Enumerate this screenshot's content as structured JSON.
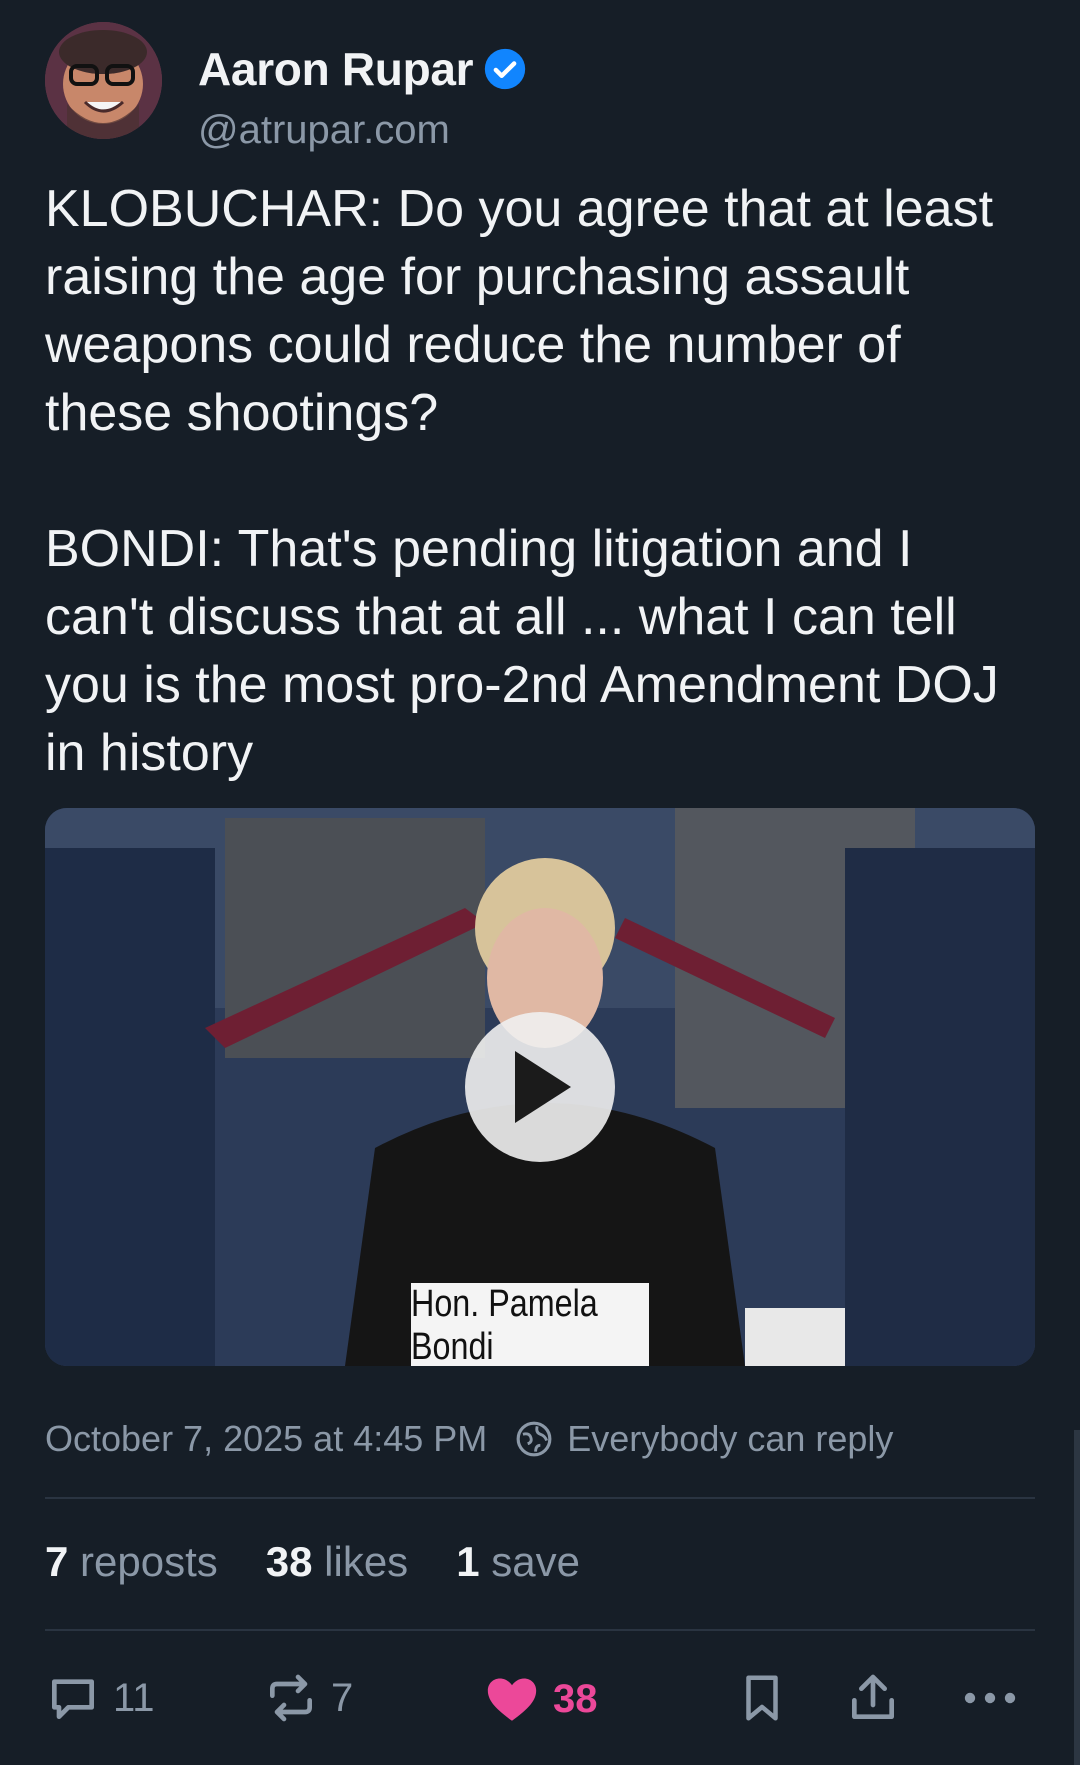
{
  "author": {
    "name": "Aaron Rupar",
    "handle": "@atrupar.com",
    "verified": true,
    "avatar_icon": "avatar-photo"
  },
  "post": {
    "text": "KLOBUCHAR: Do you agree that at least raising the age for purchasing assault weapons could reduce the number of these shootings?\n\nBONDI: That's pending litigation and I can't discuss that at all ... what I can tell you is the most pro-2nd Amendment DOJ in history",
    "video": {
      "nameplate": "Hon. Pamela Bondi",
      "play_icon": "play-icon"
    }
  },
  "meta": {
    "timestamp": "October 7, 2025 at 4:45 PM",
    "reply_setting": "Everybody can reply"
  },
  "stats": {
    "reposts_count": "7",
    "reposts_label": "reposts",
    "likes_count": "38",
    "likes_label": "likes",
    "saves_count": "1",
    "saves_label": "save"
  },
  "actions": {
    "reply_count": "11",
    "repost_count": "7",
    "like_count": "38"
  },
  "colors": {
    "background": "#161e27",
    "accent": "#1185fe",
    "like": "#ec4899",
    "muted": "#8b98a7"
  }
}
